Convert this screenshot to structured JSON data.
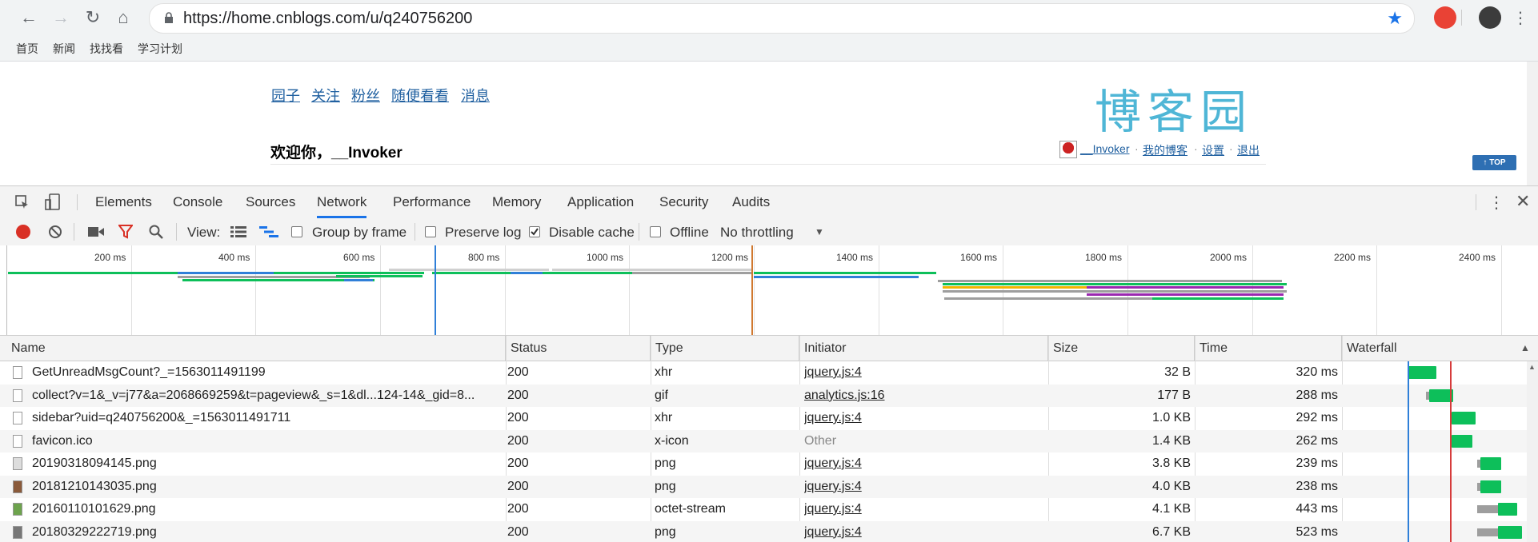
{
  "browser": {
    "url": "https://home.cnblogs.com/u/q240756200",
    "bookmarks": [
      "首页",
      "新闻",
      "找找看",
      "学习计划"
    ]
  },
  "page": {
    "nav_links": [
      "园子",
      "关注",
      "粉丝",
      "随便看看",
      "消息"
    ],
    "welcome": "欢迎你，__Invoker",
    "logo": "博客园",
    "user_links": [
      "__Invoker",
      "我的博客",
      "设置",
      "退出"
    ],
    "user_sep": "·",
    "top_button": "↑ TOP"
  },
  "devtools": {
    "tabs": [
      "Elements",
      "Console",
      "Sources",
      "Network",
      "Performance",
      "Memory",
      "Application",
      "Security",
      "Audits"
    ],
    "active_tab": "Network",
    "toolbar": {
      "view_label": "View:",
      "group_by_frame": "Group by frame",
      "preserve_log": "Preserve log",
      "disable_cache": "Disable cache",
      "offline": "Offline",
      "throttling": "No throttling"
    },
    "overview_ticks": [
      "200 ms",
      "400 ms",
      "600 ms",
      "800 ms",
      "1000 ms",
      "1200 ms",
      "1400 ms",
      "1600 ms",
      "1800 ms",
      "2000 ms",
      "2200 ms",
      "2400 ms"
    ],
    "columns": [
      "Name",
      "Status",
      "Type",
      "Initiator",
      "Size",
      "Time",
      "Waterfall"
    ],
    "requests": [
      {
        "name": "GetUnreadMsgCount?_=1563011491199",
        "status": "200",
        "type": "xhr",
        "initiator": "jquery.js:4",
        "size": "32 B",
        "time": "320 ms"
      },
      {
        "name": "collect?v=1&_v=j77&a=2068669259&t=pageview&_s=1&dl...124-14&_gid=8...",
        "status": "200",
        "type": "gif",
        "initiator": "analytics.js:16",
        "size": "177 B",
        "time": "288 ms"
      },
      {
        "name": "sidebar?uid=q240756200&_=1563011491711",
        "status": "200",
        "type": "xhr",
        "initiator": "jquery.js:4",
        "size": "1.0 KB",
        "time": "292 ms"
      },
      {
        "name": "favicon.ico",
        "status": "200",
        "type": "x-icon",
        "initiator": "Other",
        "size": "1.4 KB",
        "time": "262 ms"
      },
      {
        "name": "20190318094145.png",
        "status": "200",
        "type": "png",
        "initiator": "jquery.js:4",
        "size": "3.8 KB",
        "time": "239 ms"
      },
      {
        "name": "20181210143035.png",
        "status": "200",
        "type": "png",
        "initiator": "jquery.js:4",
        "size": "4.0 KB",
        "time": "238 ms"
      },
      {
        "name": "20160110101629.png",
        "status": "200",
        "type": "octet-stream",
        "initiator": "jquery.js:4",
        "size": "4.1 KB",
        "time": "443 ms"
      },
      {
        "name": "20180329222719.png",
        "status": "200",
        "type": "png",
        "initiator": "jquery.js:4",
        "size": "6.7 KB",
        "time": "523 ms"
      }
    ]
  },
  "colors": {
    "accent": "#1a73e8",
    "record": "#d93025",
    "bar_green": "#0dbf5a",
    "link": "#2060a0"
  }
}
